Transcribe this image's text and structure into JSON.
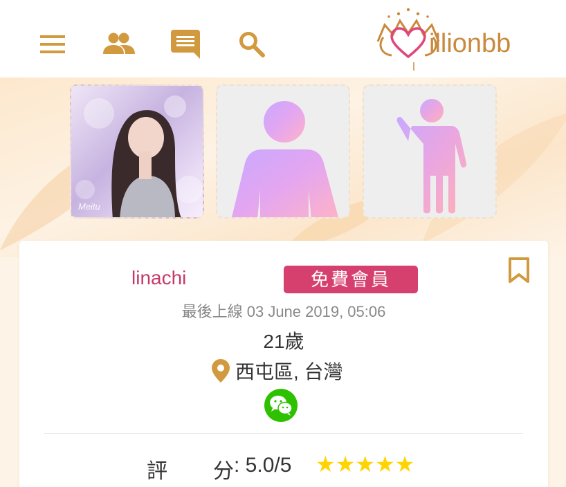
{
  "header": {
    "menu_icon": "menu-icon",
    "people_icon": "people-icon",
    "chat_icon": "chat-icon",
    "search_icon": "search-icon",
    "logo_text": "illionbb",
    "accent": "#d29a3f"
  },
  "photos": {
    "watermark": "Meitu",
    "placeholders": [
      "male-silhouette",
      "female-silhouette"
    ]
  },
  "profile": {
    "username": "linachi",
    "member_badge": "免費會員",
    "last_online": "最後上線 03 June 2019, 05:06",
    "age": "21歲",
    "location": "西屯區, 台灣",
    "contact_icon": "wechat-icon",
    "rating_label_1": "評",
    "rating_label_2": "分",
    "rating_value": ": 5.0/5",
    "stars": "★★★★★"
  },
  "colors": {
    "username": "#c7396b",
    "badge": "#d6406e",
    "icon_gold": "#d29a3f",
    "wechat": "#2dc100",
    "stars": "#ffd400"
  }
}
